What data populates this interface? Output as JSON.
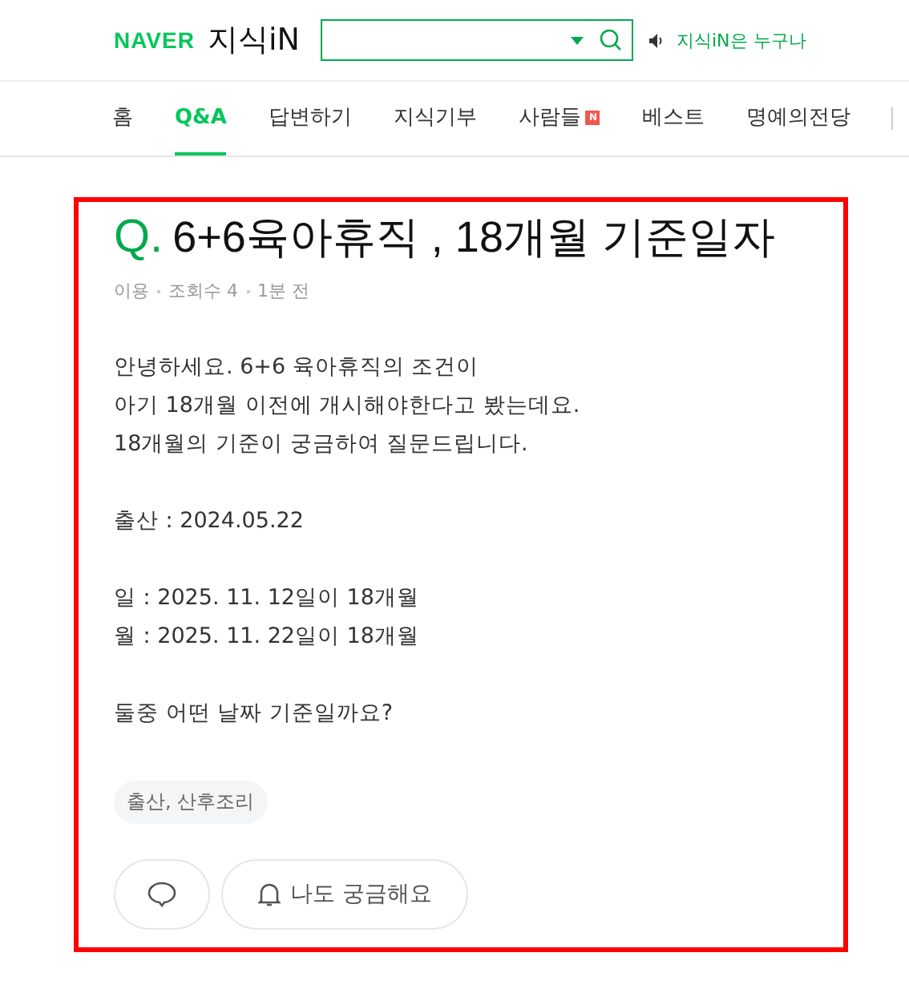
{
  "header": {
    "brand": "NAVER",
    "service": "지식iN",
    "notice": "지식iN은 누구나"
  },
  "nav": [
    {
      "label": "홈",
      "selected": false,
      "new_badge": false
    },
    {
      "label": "Q&A",
      "selected": true,
      "new_badge": false
    },
    {
      "label": "답변하기",
      "selected": false,
      "new_badge": false
    },
    {
      "label": "지식기부",
      "selected": false,
      "new_badge": false
    },
    {
      "label": "사람들",
      "selected": false,
      "new_badge": true
    },
    {
      "label": "베스트",
      "selected": false,
      "new_badge": false
    },
    {
      "label": "명예의전당",
      "selected": false,
      "new_badge": false
    }
  ],
  "nav_badge": "N",
  "question": {
    "mark": "Q.",
    "title": "6+6육아휴직 , 18개월 기준일자",
    "meta": [
      "이용",
      "조회수 4",
      "1분 전"
    ],
    "paragraphs": [
      [
        "안녕하세요. 6+6 육아휴직의 조건이",
        "아기 18개월 이전에 개시해야한다고 봤는데요.",
        "18개월의 기준이 궁금하여 질문드립니다."
      ],
      [
        "출산 : 2024.05.22"
      ],
      [
        "일 : 2025. 11. 12일이 18개월",
        "월 : 2025. 11. 22일이 18개월"
      ],
      [
        "둘중 어떤 날짜 기준일까요?"
      ]
    ],
    "tags": [
      "출산, 산후조리"
    ],
    "curious_button": "나도 궁금해요"
  },
  "highlight": true
}
